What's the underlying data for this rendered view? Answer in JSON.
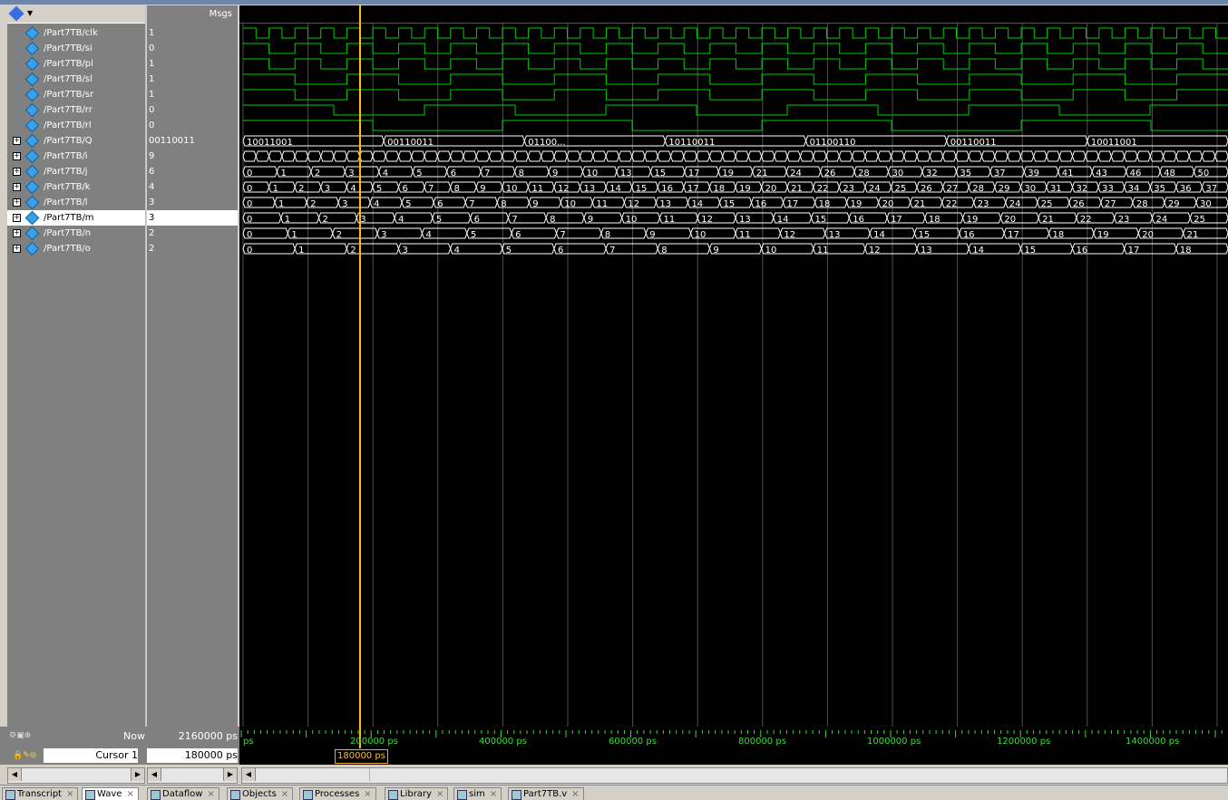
{
  "header": {
    "msgs_label": "Msgs"
  },
  "signals": [
    {
      "name": "/Part7TB/clk",
      "value": "1",
      "expandable": false,
      "selected": false
    },
    {
      "name": "/Part7TB/si",
      "value": "0",
      "expandable": false,
      "selected": false
    },
    {
      "name": "/Part7TB/pl",
      "value": "1",
      "expandable": false,
      "selected": false
    },
    {
      "name": "/Part7TB/sl",
      "value": "1",
      "expandable": false,
      "selected": false
    },
    {
      "name": "/Part7TB/sr",
      "value": "1",
      "expandable": false,
      "selected": false
    },
    {
      "name": "/Part7TB/rr",
      "value": "0",
      "expandable": false,
      "selected": false
    },
    {
      "name": "/Part7TB/rl",
      "value": "0",
      "expandable": false,
      "selected": false
    },
    {
      "name": "/Part7TB/Q",
      "value": "00110011",
      "expandable": true,
      "selected": false
    },
    {
      "name": "/Part7TB/i",
      "value": "9",
      "expandable": true,
      "selected": false
    },
    {
      "name": "/Part7TB/j",
      "value": "6",
      "expandable": true,
      "selected": false
    },
    {
      "name": "/Part7TB/k",
      "value": "4",
      "expandable": true,
      "selected": false
    },
    {
      "name": "/Part7TB/l",
      "value": "3",
      "expandable": true,
      "selected": false
    },
    {
      "name": "/Part7TB/m",
      "value": "3",
      "expandable": true,
      "selected": true
    },
    {
      "name": "/Part7TB/n",
      "value": "2",
      "expandable": true,
      "selected": false
    },
    {
      "name": "/Part7TB/o",
      "value": "2",
      "expandable": true,
      "selected": false
    }
  ],
  "bus_labels": {
    "Q": [
      "10011001",
      "00110011",
      "01100...",
      "10110011",
      "01100110",
      "00110011",
      "10011001"
    ],
    "j": [
      "0",
      "1",
      "2",
      "3",
      "4",
      "5",
      "6",
      "7",
      "8",
      "9",
      "10",
      "13",
      "15",
      "17",
      "19",
      "21",
      "24",
      "26",
      "28",
      "30",
      "32",
      "35",
      "37",
      "39",
      "41",
      "43",
      "46",
      "48",
      "50"
    ],
    "k": [
      "0",
      "1",
      "2",
      "3",
      "4",
      "5",
      "6",
      "7",
      "8",
      "9",
      "10",
      "11",
      "12",
      "13",
      "14",
      "15",
      "16",
      "17",
      "18",
      "19",
      "20",
      "21",
      "22",
      "23",
      "24",
      "25",
      "26",
      "27",
      "28",
      "29",
      "30",
      "31",
      "32",
      "33",
      "34",
      "35",
      "36",
      "37"
    ],
    "l": [
      "0",
      "1",
      "2",
      "3",
      "4",
      "5",
      "6",
      "7",
      "8",
      "9",
      "10",
      "11",
      "12",
      "13",
      "14",
      "15",
      "16",
      "17",
      "18",
      "19",
      "20",
      "21",
      "22",
      "23",
      "24",
      "25",
      "26",
      "27",
      "28",
      "29",
      "30"
    ],
    "m": [
      "0",
      "1",
      "2",
      "3",
      "4",
      "5",
      "6",
      "7",
      "8",
      "9",
      "10",
      "11",
      "12",
      "13",
      "14",
      "15",
      "16",
      "17",
      "18",
      "19",
      "20",
      "21",
      "22",
      "23",
      "24",
      "25"
    ],
    "n": [
      "0",
      "1",
      "2",
      "3",
      "4",
      "5",
      "6",
      "7",
      "8",
      "9",
      "10",
      "11",
      "12",
      "13",
      "14",
      "15",
      "16",
      "17",
      "18",
      "19",
      "20",
      "21"
    ],
    "o": [
      "0",
      "1",
      "2",
      "3",
      "4",
      "5",
      "6",
      "7",
      "8",
      "9",
      "10",
      "11",
      "12",
      "13",
      "14",
      "15",
      "16",
      "17",
      "18"
    ]
  },
  "status": {
    "now_label": "Now",
    "now_value": "2160000 ps",
    "cursor_label": "Cursor 1",
    "cursor_value": "180000 ps",
    "cursor_tag": "180000 ps"
  },
  "ruler": {
    "labels": [
      "ps",
      "200000 ps",
      "400000 ps",
      "600000 ps",
      "800000 ps",
      "1000000 ps",
      "1200000 ps",
      "1400000 ps"
    ]
  },
  "tabs": [
    {
      "label": "Transcript",
      "active": false
    },
    {
      "label": "Wave",
      "active": true
    },
    {
      "label": "Dataflow",
      "active": false
    },
    {
      "label": "Objects",
      "active": false
    },
    {
      "label": "Processes",
      "active": false
    },
    {
      "label": "Library",
      "active": false
    },
    {
      "label": "sim",
      "active": false
    },
    {
      "label": "Part7TB.v",
      "active": false
    }
  ],
  "colors": {
    "wave": "#00d000",
    "cursor": "#ffc000",
    "grid": "#505050"
  }
}
